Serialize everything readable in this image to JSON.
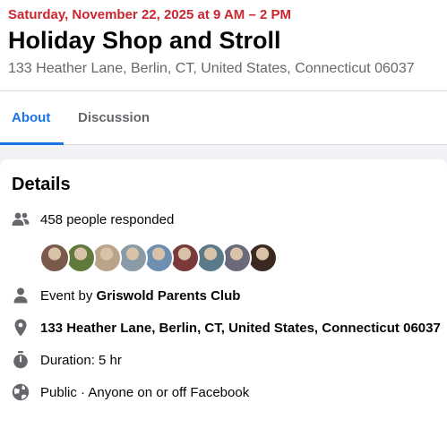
{
  "event": {
    "date": "Saturday, November 22, 2025 at 9 AM – 2 PM",
    "title": "Holiday Shop and Stroll",
    "address": "133 Heather Lane, Berlin, CT, United States, Connecticut 06037"
  },
  "tabs": [
    {
      "label": "About",
      "active": true
    },
    {
      "label": "Discussion",
      "active": false
    }
  ],
  "details": {
    "heading": "Details",
    "responded": "458 people responded",
    "avatar_colors": [
      "#7a5a4a",
      "#5f7a3a",
      "#b9a48a",
      "#8a9aa6",
      "#6f8fb2",
      "#7a3a3a",
      "#5a7a8a",
      "#6a6a7a",
      "#3a2a22"
    ],
    "event_by_prefix": "Event by ",
    "organizer": "Griswold Parents Club",
    "location": "133 Heather Lane, Berlin, CT, United States, Connecticut 06037",
    "duration": "Duration: 5 hr",
    "privacy": "Public · Anyone on or off Facebook"
  },
  "colors": {
    "date_red": "#c9262f",
    "accent_blue": "#1b74e4",
    "icon_gray": "#65676b"
  }
}
